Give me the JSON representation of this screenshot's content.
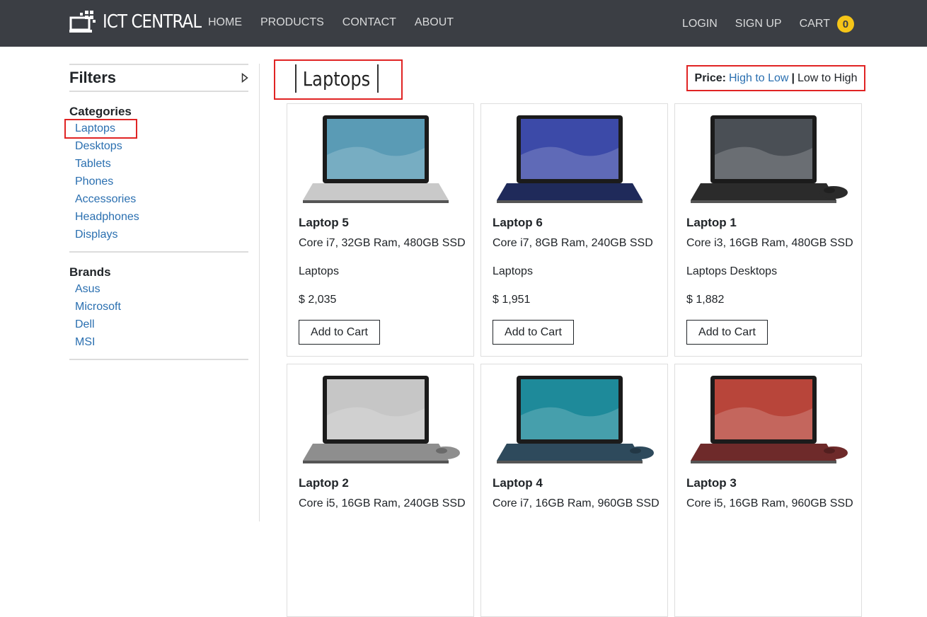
{
  "brand": {
    "name": "ICT CENTRAL"
  },
  "nav": {
    "links": [
      "HOME",
      "PRODUCTS",
      "CONTACT",
      "ABOUT"
    ],
    "login": "LOGIN",
    "signup": "SIGN UP",
    "cart": "CART",
    "cart_count": "0"
  },
  "filters": {
    "title": "Filters",
    "categories_title": "Categories",
    "categories": [
      "Laptops",
      "Desktops",
      "Tablets",
      "Phones",
      "Accessories",
      "Headphones",
      "Displays"
    ],
    "active_category": "Laptops",
    "brands_title": "Brands",
    "brands": [
      "Asus",
      "Microsoft",
      "Dell",
      "MSI"
    ]
  },
  "main": {
    "title": "Laptops",
    "sort": {
      "label": "Price:",
      "high_to_low": "High to Low",
      "separator": "|",
      "low_to_high": "Low to High"
    }
  },
  "products": [
    {
      "name": "Laptop 5",
      "spec": "Core i7, 32GB Ram, 480GB SSD",
      "categories": "Laptops",
      "price": "$ 2,035",
      "button": "Add to Cart",
      "screen_color": "#5a9bb5",
      "body_color": "#c9c9c9",
      "mouse": false
    },
    {
      "name": "Laptop 6",
      "spec": "Core i7, 8GB Ram, 240GB SSD",
      "categories": "Laptops",
      "price": "$ 1,951",
      "button": "Add to Cart",
      "screen_color": "#3c4aa8",
      "body_color": "#1f2a5a",
      "mouse": false
    },
    {
      "name": "Laptop 1",
      "spec": "Core i3, 16GB Ram, 480GB SSD",
      "categories": "Laptops Desktops",
      "price": "$ 1,882",
      "button": "Add to Cart",
      "screen_color": "#4a4f55",
      "body_color": "#2b2b2b",
      "mouse": true
    },
    {
      "name": "Laptop 2",
      "spec": "Core i5, 16GB Ram, 240GB SSD",
      "categories": "",
      "price": "",
      "button": "",
      "screen_color": "#c6c6c6",
      "body_color": "#8e8e8e",
      "mouse": true
    },
    {
      "name": "Laptop 4",
      "spec": "Core i7, 16GB Ram, 960GB SSD",
      "categories": "",
      "price": "",
      "button": "",
      "screen_color": "#1e8a9a",
      "body_color": "#2e4a5c",
      "mouse": true
    },
    {
      "name": "Laptop 3",
      "spec": "Core i5, 16GB Ram, 960GB SSD",
      "categories": "",
      "price": "",
      "button": "",
      "screen_color": "#b8453a",
      "body_color": "#6e2a2a",
      "mouse": true
    }
  ]
}
